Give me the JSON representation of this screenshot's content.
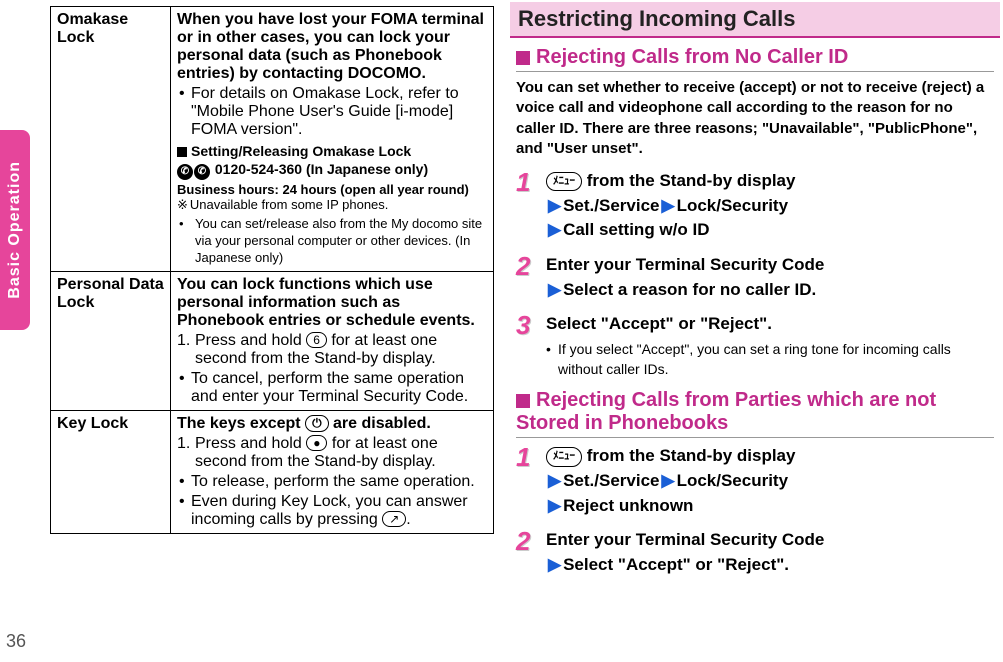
{
  "side_tab": "Basic Operation",
  "page_number": "36",
  "table": {
    "rows": [
      {
        "label": "Omakase Lock",
        "main": "When you have lost your FOMA terminal or in other cases, you can lock your personal data (such as Phonebook entries) by contacting DOCOMO.",
        "b1": "For details on Omakase Lock, refer to \"Mobile Phone User's Guide [i-mode] FOMA version\".",
        "sub_h": "Setting/Releasing Omakase Lock",
        "phone": "0120-524-360 (In Japanese only)",
        "hours": "Business hours: 24 hours (open all year round)",
        "note1": "Unavailable from some IP phones.",
        "note2": "You can set/release also from the My docomo site via your personal computer or other devices. (In Japanese only)"
      },
      {
        "label": "Personal Data Lock",
        "main": "You can lock functions which use personal information such as Phonebook entries or schedule events.",
        "n1a": "Press and hold ",
        "n1_icon": "6",
        "n1b": " for at least one second from the Stand-by display.",
        "b1": "To cancel, perform the same operation and enter your Terminal Security Code."
      },
      {
        "label": "Key Lock",
        "main_a": "The keys except ",
        "main_icon": "⏻",
        "main_b": " are disabled.",
        "n1a": "Press and hold ",
        "n1_icon": "●",
        "n1b": " for at least one second from the Stand-by display.",
        "b1": "To release, perform the same operation.",
        "b2a": "Even during Key Lock, you can answer incoming calls by pressing ",
        "b2_icon": "↗",
        "b2b": "."
      }
    ]
  },
  "right": {
    "title": "Restricting Incoming Calls",
    "sec1": {
      "title": "Rejecting Calls from No Caller ID",
      "body": "You can set whether to receive (accept) or not to receive (reject) a voice call and videophone call according to the reason for no caller ID. There are three reasons; \"Unavailable\", \"PublicPhone\", and \"User unset\".",
      "steps": [
        {
          "num": "1",
          "icon": "ﾒﾆｭｰ",
          "l1": " from the Stand-by display",
          "l2a": "Set./Service",
          "l2b": "Lock/Security",
          "l3": "Call setting w/o ID"
        },
        {
          "num": "2",
          "l1": "Enter your Terminal Security Code",
          "l2": "Select a reason for no caller ID."
        },
        {
          "num": "3",
          "l1": "Select \"Accept\" or \"Reject\".",
          "note": "If you select \"Accept\", you can set a ring tone for incoming calls without caller IDs."
        }
      ]
    },
    "sec2": {
      "title": "Rejecting Calls from Parties which are not Stored in Phonebooks",
      "steps": [
        {
          "num": "1",
          "icon": "ﾒﾆｭｰ",
          "l1": " from the Stand-by display",
          "l2a": "Set./Service",
          "l2b": "Lock/Security",
          "l3": "Reject unknown"
        },
        {
          "num": "2",
          "l1": "Enter your Terminal Security Code",
          "l2": "Select \"Accept\" or \"Reject\"."
        }
      ]
    }
  }
}
